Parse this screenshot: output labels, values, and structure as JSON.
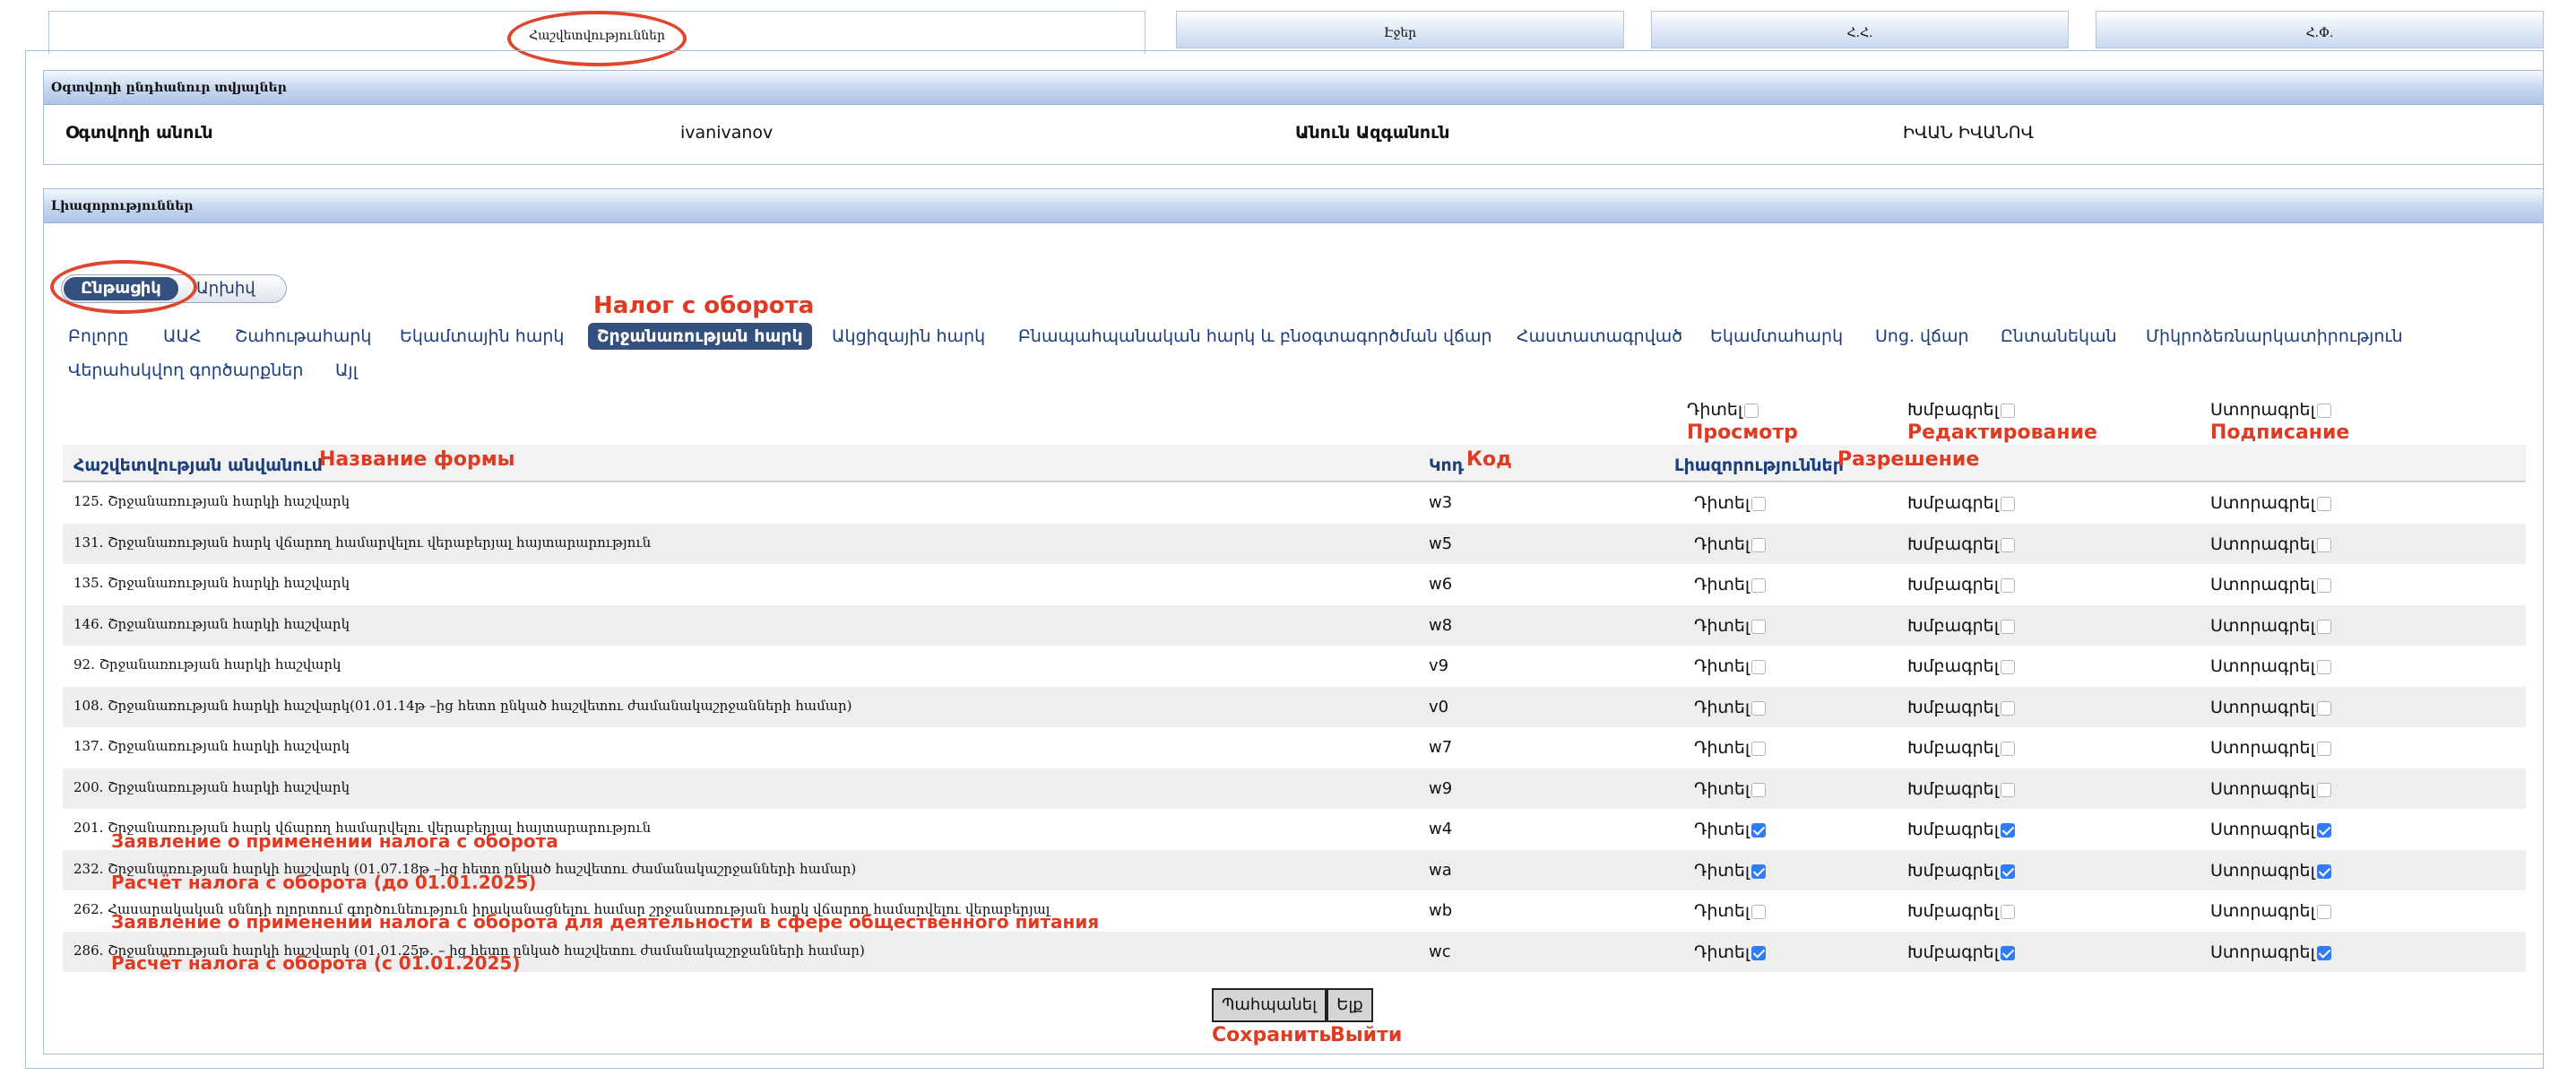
{
  "tabs": [
    {
      "label": "Հաշվետվություններ",
      "active": true
    },
    {
      "label": "Էջեր",
      "active": false
    },
    {
      "label": "Հ.Հ.",
      "active": false
    },
    {
      "label": "Հ.Փ.",
      "active": false
    }
  ],
  "user_panel": {
    "title": "Օգտվողի ընդհանուր տվյալներ",
    "username_label": "Օգտվողի անուն",
    "username_value": "ivanivanov",
    "fullname_label": "Անուն Ազգանուն",
    "fullname_value": "ԻՎԱՆ ԻՎԱՆՈՎ"
  },
  "permissions_panel": {
    "title": "Լիազորություններ",
    "toggle": {
      "current": "Ընթացիկ",
      "archive": "Արխիվ"
    },
    "tax_types": [
      "Բոլորը",
      "ԱԱՀ",
      "Շահութահարկ",
      "Եկամտային հարկ",
      "Շրջանառության հարկ",
      "Ակցիզային հարկ",
      "Բնապահպանական հարկ և բնօգտագործման վճար",
      "Հաստատագրված",
      "Եկամտահարկ",
      "Սոց. վճար",
      "Ընտանեկան",
      "Միկրոձեռնարկատիրություն",
      "Վերահսկվող գործարքներ",
      "Այլ"
    ],
    "active_tax_type": "Շրջանառության հարկ",
    "bulk": {
      "view": "Դիտել",
      "edit": "Խմբագրել",
      "sign": "Ստորագրել"
    },
    "columns": {
      "name": "Հաշվետվության անվանում",
      "code": "Կոդ",
      "permissions": "Լիազորություններ"
    },
    "perm_labels": {
      "view": "Դիտել",
      "edit": "Խմբագրել",
      "sign": "Ստորագրել"
    },
    "rows": [
      {
        "name": "125. Շրջանառության հարկի հաշվարկ",
        "code": "w3",
        "view": false,
        "edit": false,
        "sign": false
      },
      {
        "name": "131. Շրջանառության հարկ վճարող համարվելու վերաբերյալ հայտարարություն",
        "code": "w5",
        "view": false,
        "edit": false,
        "sign": false
      },
      {
        "name": "135. Շրջանառության հարկի հաշվարկ",
        "code": "w6",
        "view": false,
        "edit": false,
        "sign": false
      },
      {
        "name": "146. Շրջանառության հարկի հաշվարկ",
        "code": "w8",
        "view": false,
        "edit": false,
        "sign": false
      },
      {
        "name": "92. Շրջանառության հարկի հաշվարկ",
        "code": "v9",
        "view": false,
        "edit": false,
        "sign": false
      },
      {
        "name": "108. Շրջանառության հարկի հաշվարկ(01.01.14թ –ից հետո ընկած հաշվետու ժամանակաշրջանների համար)",
        "code": "v0",
        "view": false,
        "edit": false,
        "sign": false
      },
      {
        "name": "137. Շրջանառության հարկի հաշվարկ",
        "code": "w7",
        "view": false,
        "edit": false,
        "sign": false
      },
      {
        "name": "200. Շրջանառության հարկի հաշվարկ",
        "code": "w9",
        "view": false,
        "edit": false,
        "sign": false
      },
      {
        "name": "201. Շրջանառության հարկ վճարող համարվելու վերաբերյալ հայտարարություն",
        "code": "w4",
        "view": true,
        "edit": true,
        "sign": true
      },
      {
        "name": "232. Շրջանառության հարկի հաշվարկ (01.07.18թ –ից հետո ընկած հաշվետու ժամանակաշրջանների համար)",
        "code": "wa",
        "view": true,
        "edit": true,
        "sign": true
      },
      {
        "name": "262. Հասարակական սննդի ոլորտում գործունեություն իրականացնելու համար շրջանառության հարկ վճարող համարվելու վերաբերյալ",
        "code": "wb",
        "view": false,
        "edit": false,
        "sign": false
      },
      {
        "name": "286. Շրջանառության հարկի հաշվարկ (01.01.25թ. – ից հետո ընկած հաշվետու ժամանակաշրջանների համար)",
        "code": "wc",
        "view": true,
        "edit": true,
        "sign": true
      }
    ],
    "save_button": "Պահպանել",
    "exit_button": "Ելք"
  },
  "annotations": {
    "tax_type": "Налог с оборота",
    "view": "Просмотр",
    "edit": "Редактирование",
    "sign": "Подписание",
    "name_col": "Название формы",
    "code_col": "Код",
    "perm_col": "Разрешение",
    "row_201": "Заявление о применении налога с оборота",
    "row_232": "Расчёт налога с оборота (до 01.01.2025)",
    "row_262": "Заявление о применении налога с оборота для деятельности в сфере общественного питания",
    "row_286": "Расчёт налога с оборота (с 01.01.2025)",
    "save": "Сохранить",
    "exit": "Выйти"
  },
  "colors": {
    "annotation": "#e03a22",
    "active_pill": "#34507e",
    "checkbox_checked": "#2f7cf6",
    "panel_header": "#c9d8f1"
  }
}
